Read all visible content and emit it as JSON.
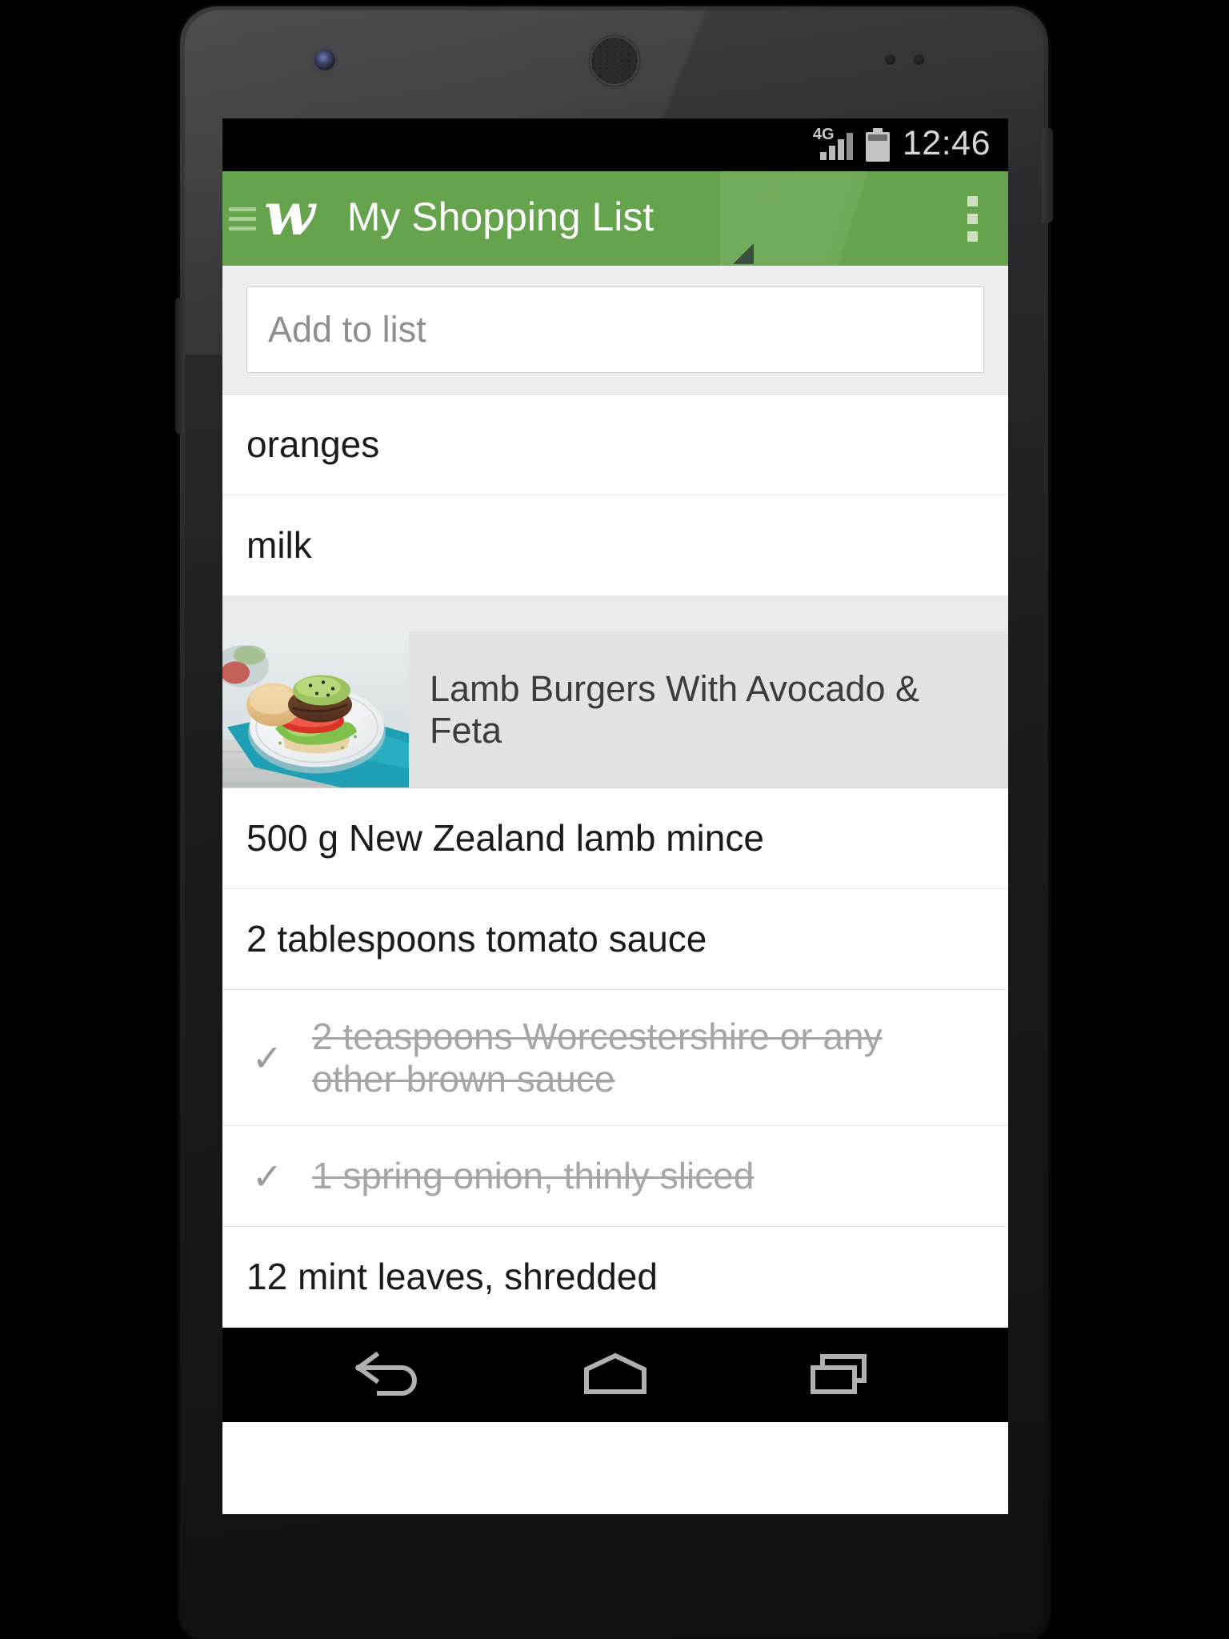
{
  "statusbar": {
    "network_label": "4G",
    "time": "12:46",
    "battery_icon": "battery-icon",
    "signal_icon": "signal-bars-icon"
  },
  "appbar": {
    "menu_icon": "hamburger-menu-icon",
    "brand_logo": "w-script-logo",
    "brand_letter": "w",
    "title": "My Shopping List",
    "overflow_icon": "overflow-menu-icon",
    "background_color": "#65a34c",
    "title_color": "#ffffff"
  },
  "add_field": {
    "placeholder": "Add to list",
    "value": ""
  },
  "list": {
    "items": [
      {
        "text": "oranges",
        "checked": false,
        "type": "item"
      },
      {
        "text": "milk",
        "checked": false,
        "type": "item"
      }
    ],
    "recipe": {
      "title": "Lamb Burgers With Avocado & Feta",
      "thumbnail_alt": "lamb-burger-photo",
      "ingredients": [
        {
          "text": "500 g New Zealand lamb mince",
          "checked": false
        },
        {
          "text": "2 tablespoons tomato sauce",
          "checked": false
        },
        {
          "text": "2 teaspoons Worcestershire or any other brown sauce",
          "checked": true
        },
        {
          "text": "1 spring onion, thinly sliced",
          "checked": true
        },
        {
          "text": "12 mint leaves, shredded",
          "checked": false
        }
      ]
    },
    "check_glyph": "✓"
  },
  "navbar": {
    "back_icon": "back-arrow-icon",
    "home_icon": "home-icon",
    "recents_icon": "recent-apps-icon"
  },
  "hardware": {
    "front_camera": "front-camera",
    "earpiece": "earpiece-speaker",
    "power_button": "power-button",
    "volume_button": "volume-rocker"
  }
}
